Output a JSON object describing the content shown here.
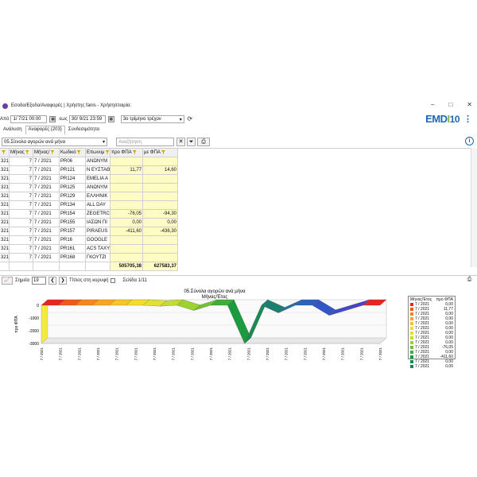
{
  "window": {
    "title": "Εσοδα/Εξοδα/Αναφορές  | Χρήστης fanis - Χρήση/εταιρία:",
    "min_glyph": "–",
    "max_glyph": "□",
    "close_glyph": "✕"
  },
  "brand": {
    "part1": "EMD",
    "part2": "I",
    "part3": "10"
  },
  "filters": {
    "from_label": "Από",
    "from_value": "1/  7/21 00:00",
    "to_label": "εως",
    "to_value": "30/  9/21 23:59",
    "period_value": "3ο τρίμηνο τρέχον"
  },
  "tabs": [
    {
      "label": "Ανάλυση"
    },
    {
      "label": "Αναφορές (203)"
    },
    {
      "label": "Συνδεσιμότητα"
    }
  ],
  "report": {
    "selected": "05.Σύνολα αγορών ανά μήνα",
    "search_placeholder": "Αναζήτηση"
  },
  "grid": {
    "headers": [
      "",
      "Μήνας",
      "Μήνας/",
      "Κωδικό",
      "Επωνυμ",
      "προ ΦΠΑ",
      "με ΦΠΑ"
    ],
    "rows": [
      [
        "321",
        "7",
        "7 / 2021",
        "PR06",
        "ΑΝΩΝΥΜ",
        "",
        ""
      ],
      [
        "321",
        "7",
        "7 / 2021",
        "PR121",
        "Ν ΕΥΣΤΑΘ",
        "11,77",
        "14,60"
      ],
      [
        "321",
        "7",
        "7 / 2021",
        "PR124",
        "EMELIA A",
        "",
        ""
      ],
      [
        "321",
        "7",
        "7 / 2021",
        "PR125",
        "ΑΝΩΝΥΜ",
        "",
        ""
      ],
      [
        "321",
        "7",
        "7 / 2021",
        "PR129",
        "ΕΛΛΗΝΙΚ",
        "",
        ""
      ],
      [
        "321",
        "7",
        "7 / 2021",
        "PR134",
        "ALL DAY",
        "",
        ""
      ],
      [
        "321",
        "7",
        "7 / 2021",
        "PR154",
        "ZEGETRC",
        "-76,05",
        "-94,30"
      ],
      [
        "321",
        "7",
        "7 / 2021",
        "PR155",
        "ΙΑΣΩΝ ΠΙ",
        "0,00",
        "0,00"
      ],
      [
        "321",
        "7",
        "7 / 2021",
        "PR157",
        "PIRAEUS",
        "-411,60",
        "-436,30"
      ],
      [
        "321",
        "7",
        "7 / 2021",
        "PR16",
        "GOOGLE",
        "",
        ""
      ],
      [
        "321",
        "7",
        "7 / 2021",
        "PR161",
        "ACS TAXY",
        "",
        ""
      ],
      [
        "321",
        "7",
        "7 / 2021",
        "PR168",
        "ΓΚΟΥΤΖΙ",
        "",
        ""
      ]
    ],
    "totals": [
      "",
      "",
      "",
      "",
      "",
      "505705,38",
      "627583,37"
    ]
  },
  "chart_toolbar": {
    "points_label": "Σημεία",
    "points_value": "19",
    "title_top_label": "Τίτλος στη κορυφή",
    "page_label": "Σελίδα 1/11"
  },
  "chart_data": {
    "type": "area",
    "title": "05.Σύνολα αγορών ανά μήνα",
    "subtitle": "Μήνας/Έτος",
    "ylabel": "προ ΦΠΑ",
    "yticks": [
      "0",
      "-1000",
      "-2000",
      "-3000"
    ],
    "ylim": [
      -3000,
      0
    ],
    "categories": [
      "7 / 2021",
      "7 / 2021",
      "7 / 2021",
      "7 / 2021",
      "7 / 2021",
      "7 / 2021",
      "7 / 2021",
      "7 / 2021",
      "7 / 2021",
      "7 / 2021",
      "7 / 2021",
      "7 / 2021",
      "7 / 2021",
      "7 / 2021",
      "7 / 2021",
      "7 / 2021",
      "7 / 2021",
      "7 / 2021",
      "7 / 2021"
    ],
    "values": [
      0,
      0,
      0,
      0,
      0,
      11.77,
      0,
      -76.05,
      0,
      -411.6,
      0,
      0,
      -3000,
      0,
      -600,
      0,
      0,
      -800,
      -400,
      0,
      0
    ],
    "colors": [
      "#e8251e",
      "#ef5a1c",
      "#f4861f",
      "#f7a623",
      "#f9c42b",
      "#f6dd2d",
      "#e2e22e",
      "#c2dc2f",
      "#9bd131",
      "#6fc234",
      "#3fae38",
      "#1c9a40",
      "#1a8a53",
      "#1d7f6e",
      "#2471a0",
      "#2a63b8",
      "#3456c4",
      "#3e4ac8",
      "#4a40c9"
    ],
    "legend_title_left": "Μήνας/Έτος",
    "legend_title_right": "προ ΦΠΑ",
    "legend": [
      {
        "period": "7 / 2021",
        "value": "0,00"
      },
      {
        "period": "7 / 2021",
        "value": "11,77"
      },
      {
        "period": "7 / 2021",
        "value": "0,00"
      },
      {
        "period": "7 / 2021",
        "value": "0,00"
      },
      {
        "period": "7 / 2021",
        "value": "0,00"
      },
      {
        "period": "7 / 2021",
        "value": "0,00"
      },
      {
        "period": "7 / 2021",
        "value": "0,00"
      },
      {
        "period": "7 / 2021",
        "value": "0,00"
      },
      {
        "period": "7 / 2021",
        "value": "0,00"
      },
      {
        "period": "7 / 2021",
        "value": "-76,05"
      },
      {
        "period": "7 / 2021",
        "value": "0,00"
      },
      {
        "period": "7 / 2021",
        "value": "-411,60"
      },
      {
        "period": "7 / 2021",
        "value": "0,00"
      },
      {
        "period": "7 / 2021",
        "value": "0,00"
      }
    ]
  }
}
